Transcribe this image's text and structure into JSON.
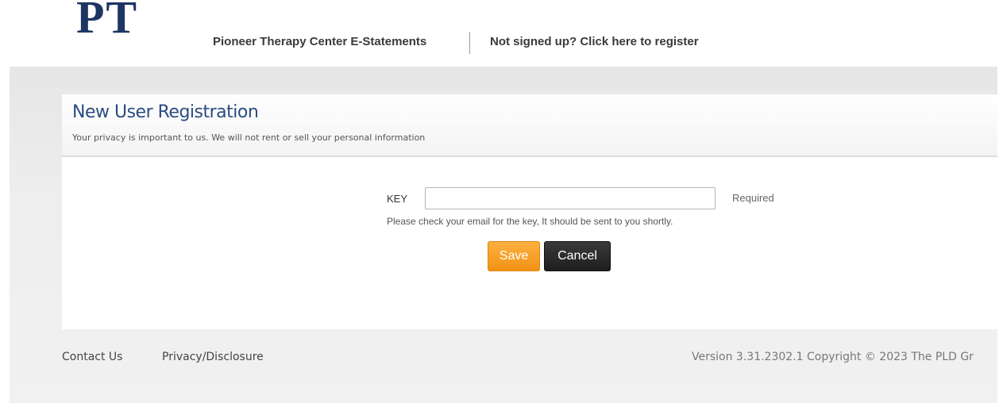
{
  "header": {
    "logo_text": "PT",
    "site_link": "Pioneer Therapy Center E-Statements",
    "register_link": "Not signed up? Click here to register"
  },
  "panel": {
    "title": "New User Registration",
    "subtitle": "Your privacy is important to us. We will not rent or sell your personal information"
  },
  "form": {
    "key_label": "KEY",
    "key_value": "",
    "required_text": "Required",
    "hint": "Please check your email for the key, It should be sent to you shortly.",
    "save_label": "Save",
    "cancel_label": "Cancel"
  },
  "footer": {
    "contact": "Contact Us",
    "privacy": "Privacy/Disclosure",
    "version": "Version 3.31.2302.1 Copyright © 2023 The PLD Gr"
  },
  "colors": {
    "title_blue": "#2a4c80",
    "save_orange": "#f7a12a",
    "cancel_black": "#262626",
    "logo_navy": "#1d3563"
  }
}
